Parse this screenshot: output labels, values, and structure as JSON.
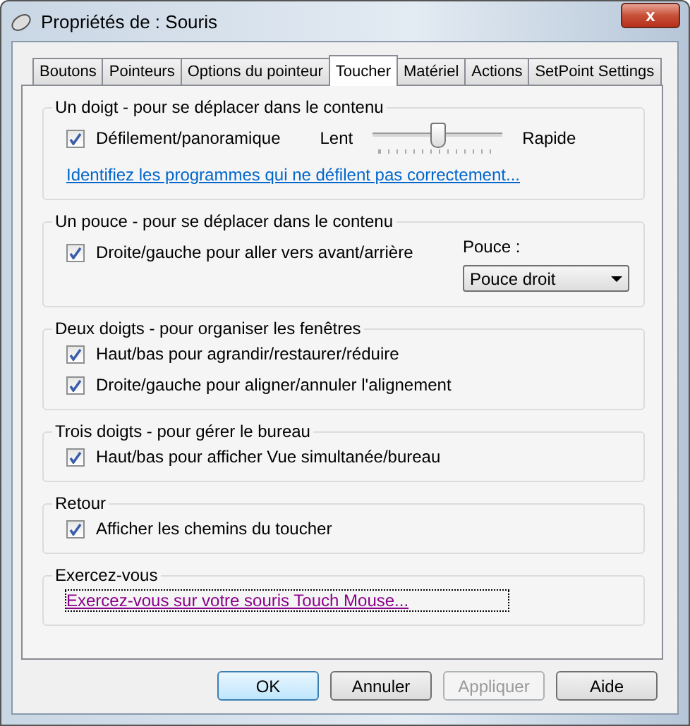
{
  "window": {
    "title": "Propriétés de : Souris",
    "close": "x"
  },
  "tabs": [
    {
      "label": "Boutons",
      "selected": false
    },
    {
      "label": "Pointeurs",
      "selected": false
    },
    {
      "label": "Options du pointeur",
      "selected": false
    },
    {
      "label": "Toucher",
      "selected": true
    },
    {
      "label": "Matériel",
      "selected": false
    },
    {
      "label": "Actions",
      "selected": false
    },
    {
      "label": "SetPoint Settings",
      "selected": false
    }
  ],
  "groups": [
    {
      "title": "Un doigt - pour se déplacer dans le contenu",
      "items": [
        {
          "kind": "checkbox_slider",
          "label": "Défilement/panoramique",
          "checked": true,
          "slider": {
            "min_label": "Lent",
            "max_label": "Rapide",
            "level": 0.5
          }
        },
        {
          "kind": "link",
          "label": "Identifiez les programmes qui ne défilent pas correctement...",
          "visited": false,
          "focused": false
        }
      ]
    },
    {
      "title": "Un pouce - pour se déplacer dans le contenu",
      "items": [
        {
          "kind": "checkbox_dropdown",
          "label": "Droite/gauche pour aller vers avant/arrière",
          "checked": true,
          "dropdown": {
            "label": "Pouce :",
            "value": "Pouce droit"
          }
        }
      ]
    },
    {
      "title": "Deux doigts - pour organiser les fenêtres",
      "items": [
        {
          "kind": "checkbox",
          "label": "Haut/bas pour agrandir/restaurer/réduire",
          "checked": true
        },
        {
          "kind": "checkbox",
          "label": "Droite/gauche pour aligner/annuler l'alignement",
          "checked": true
        }
      ]
    },
    {
      "title": "Trois doigts - pour gérer le bureau",
      "items": [
        {
          "kind": "checkbox",
          "label": "Haut/bas pour afficher Vue simultanée/bureau",
          "checked": true
        }
      ]
    },
    {
      "title": "Retour",
      "items": [
        {
          "kind": "checkbox",
          "label": "Afficher les chemins du toucher",
          "checked": true
        }
      ]
    },
    {
      "title": "Exercez-vous",
      "items": [
        {
          "kind": "link",
          "label": "Exercez-vous sur votre souris Touch Mouse...",
          "visited": true,
          "focused": true
        }
      ]
    }
  ],
  "buttons": [
    {
      "label": "OK",
      "default": true,
      "disabled": false
    },
    {
      "label": "Annuler",
      "default": false,
      "disabled": false
    },
    {
      "label": "Appliquer",
      "default": false,
      "disabled": true
    },
    {
      "label": "Aide",
      "default": false,
      "disabled": false
    }
  ]
}
